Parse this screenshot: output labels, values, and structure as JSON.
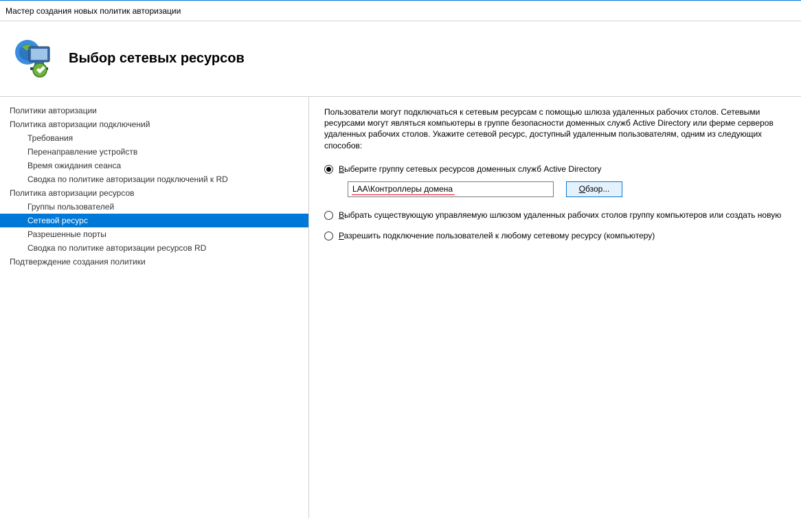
{
  "window": {
    "title": "Мастер создания новых политик авторизации"
  },
  "header": {
    "title": "Выбор сетевых ресурсов"
  },
  "sidebar": {
    "items": [
      {
        "label": "Политики авторизации",
        "level": 1,
        "selected": false
      },
      {
        "label": "Политика авторизации подключений",
        "level": 1,
        "selected": false
      },
      {
        "label": "Требования",
        "level": 2,
        "selected": false
      },
      {
        "label": "Перенаправление устройств",
        "level": 2,
        "selected": false
      },
      {
        "label": "Время ожидания сеанса",
        "level": 2,
        "selected": false
      },
      {
        "label": "Сводка по политике авторизации подключений к RD",
        "level": 2,
        "selected": false
      },
      {
        "label": "Политика авторизации ресурсов",
        "level": 1,
        "selected": false
      },
      {
        "label": "Группы пользователей",
        "level": 2,
        "selected": false
      },
      {
        "label": "Сетевой ресурс",
        "level": 2,
        "selected": true
      },
      {
        "label": "Разрешенные порты",
        "level": 2,
        "selected": false
      },
      {
        "label": "Сводка по политике авторизации ресурсов RD",
        "level": 2,
        "selected": false
      },
      {
        "label": "Подтверждение создания политики",
        "level": 1,
        "selected": false
      }
    ]
  },
  "main": {
    "description": "Пользователи могут подключаться к сетевым ресурсам с помощью шлюза удаленных рабочих столов. Сетевыми ресурсами могут являться компьютеры в группе безопасности доменных служб Active Directory или ферме серверов удаленных рабочих столов. Укажите сетевой ресурс, доступный удаленным пользователям, одним из следующих способов:",
    "option1": {
      "prefix": "В",
      "rest": "ыберите группу сетевых ресурсов доменных служб Active Directory",
      "checked": true,
      "value": "LAA\\Контроллеры домена",
      "browse_prefix": "О",
      "browse_rest": "бзор..."
    },
    "option2": {
      "prefix": "В",
      "rest": "ыбрать существующую управляемую шлюзом удаленных рабочих столов группу компьютеров или создать новую",
      "checked": false
    },
    "option3": {
      "prefix": "Р",
      "rest": "азрешить подключение пользователей к любому сетевому ресурсу (компьютеру)",
      "checked": false
    }
  }
}
